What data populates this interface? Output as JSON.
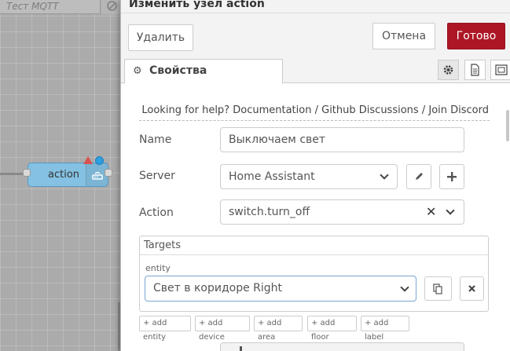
{
  "workspace": {
    "tab_label": "Тест MQTT",
    "node_label": "action"
  },
  "dialog": {
    "title": "Изменить узел action",
    "delete_label": "Удалить",
    "cancel_label": "Отмена",
    "done_label": "Готово",
    "tab_properties": "Свойства",
    "help": {
      "prefix": "Looking for help?",
      "documentation": "Documentation",
      "sep1": "/",
      "github": "Github Discussions",
      "sep2": "/",
      "discord": "Join Discord"
    },
    "name_label": "Name",
    "name_value": "Выключаем свет",
    "server_label": "Server",
    "server_value": "Home Assistant",
    "action_label": "Action",
    "action_value": "switch.turn_off",
    "action_clear": "✕",
    "targets_title": "Targets",
    "entity_label": "entity",
    "entity_value": "Свет в коридоре Right",
    "add_entity": "+ add entity",
    "add_device": "+ add device",
    "add_area": "+ add area",
    "add_floor": "+ add floor",
    "add_label": "+ add label"
  },
  "colors": {
    "done_button": "#ad1625",
    "node_fill": "#84c1e2",
    "changed_badge": "#2d9fe0",
    "warning_badge": "#d9534f"
  }
}
